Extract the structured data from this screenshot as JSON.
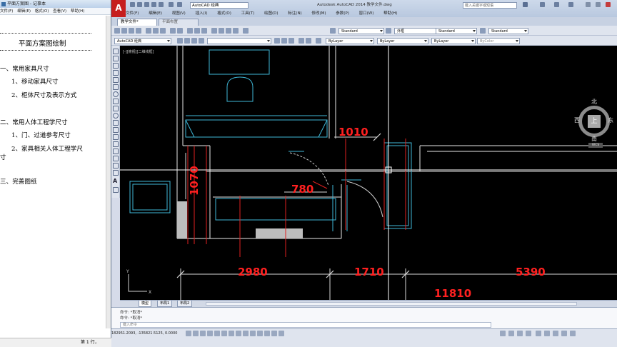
{
  "notepad": {
    "title": "平面方案图 - 记事本",
    "menu": [
      "文件(F)",
      "编辑(E)",
      "格式(O)",
      "查看(V)",
      "帮助(H)"
    ],
    "lines": [
      "平面方案图绘制",
      "一、常用家具尺寸",
      "1、移动家具尺寸",
      "2、柜体尺寸及表示方式",
      "二、常用人体工程学尺寸",
      "1、门、过道参考尺寸",
      "2、家具相关人体工程学尺",
      "寸",
      "三、完善图纸"
    ],
    "status": "第 1 行，"
  },
  "cad": {
    "workspace": "AutoCAD 经典",
    "app_title": "Autodesk AutoCAD 2014    教学文件.dwg",
    "search_placeholder": "键入关键字或短语",
    "menu": [
      "文件(F)",
      "编辑(E)",
      "视图(V)",
      "插入(I)",
      "格式(O)",
      "工具(T)",
      "绘图(D)",
      "标注(N)",
      "修改(M)",
      "参数(P)",
      "窗口(W)",
      "帮助(H)"
    ],
    "doc_tabs": [
      "教学文件*",
      "平面布置"
    ],
    "toolbar": {
      "workspace2": "AutoCAD 经典",
      "text_style": "Standard",
      "dim_style": "外框",
      "table_style": "Standard",
      "mleader_style": "Standard",
      "layer_color": "ByLayer",
      "linetype": "ByLayer",
      "lineweight": "ByLayer",
      "plot_style": "ByColor"
    },
    "view_label": "[-][俯视][二维线框]",
    "compass": {
      "north": "北",
      "south": "南",
      "east": "东",
      "west": "西",
      "center": "上",
      "wcs": "WCS"
    },
    "dimensions": {
      "d1010": "1010",
      "d1070": "1070",
      "d780": "780",
      "d2980": "2980",
      "d1710": "1710",
      "d5390": "5390",
      "d11810": "11810"
    },
    "axis": {
      "x": "X",
      "y": "Y"
    },
    "layout_tabs": [
      "模型",
      "布局1",
      "布局2"
    ],
    "cmd_history": [
      "命令: *取消*",
      "命令: *取消*"
    ],
    "cmd_placeholder": "键入命令",
    "coords": "182951.2093, -135821.5125, 0.0000"
  }
}
